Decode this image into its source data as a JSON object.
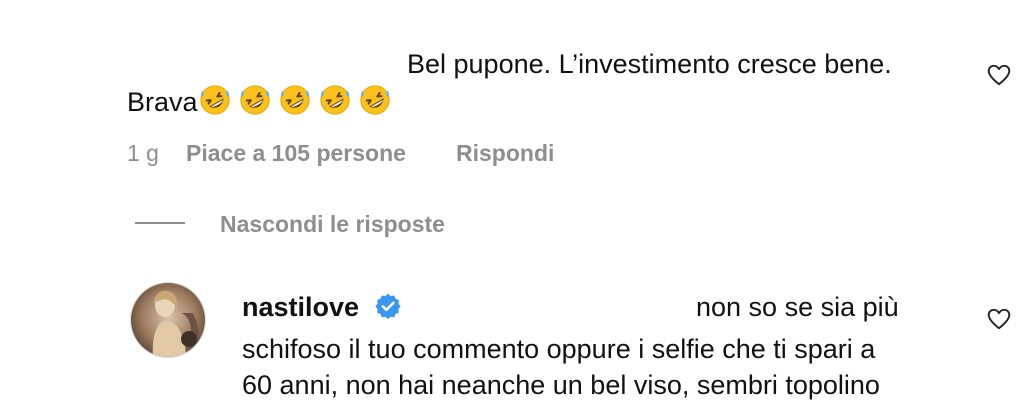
{
  "comment": {
    "text_line1": "Bel pupone. L’investimento cresce bene.",
    "text_line2_prefix": "Brava",
    "emoji_names": [
      "rolling-on-floor-laughing-emoji",
      "rolling-on-floor-laughing-emoji",
      "rolling-on-floor-laughing-emoji",
      "rolling-on-floor-laughing-emoji",
      "rolling-on-floor-laughing-emoji"
    ],
    "time": "1 g",
    "likes": "Piace a 105 persone",
    "reply": "Rispondi",
    "like_icon": "heart-outline-icon"
  },
  "replies_toggle": {
    "label": "Nascondi le risposte"
  },
  "reply_comment": {
    "username": "nastilove",
    "verified_icon": "verified-badge-icon",
    "text_line1": "non so se sia più",
    "text_line2": "schifoso il tuo commento oppure i selfie che ti spari a",
    "text_line3": "60 anni, non hai neanche un bel viso, sembri topolino",
    "like_icon": "heart-outline-icon"
  },
  "colors": {
    "verified_blue": "#3897f0",
    "secondary_text": "#8e8e8e"
  }
}
